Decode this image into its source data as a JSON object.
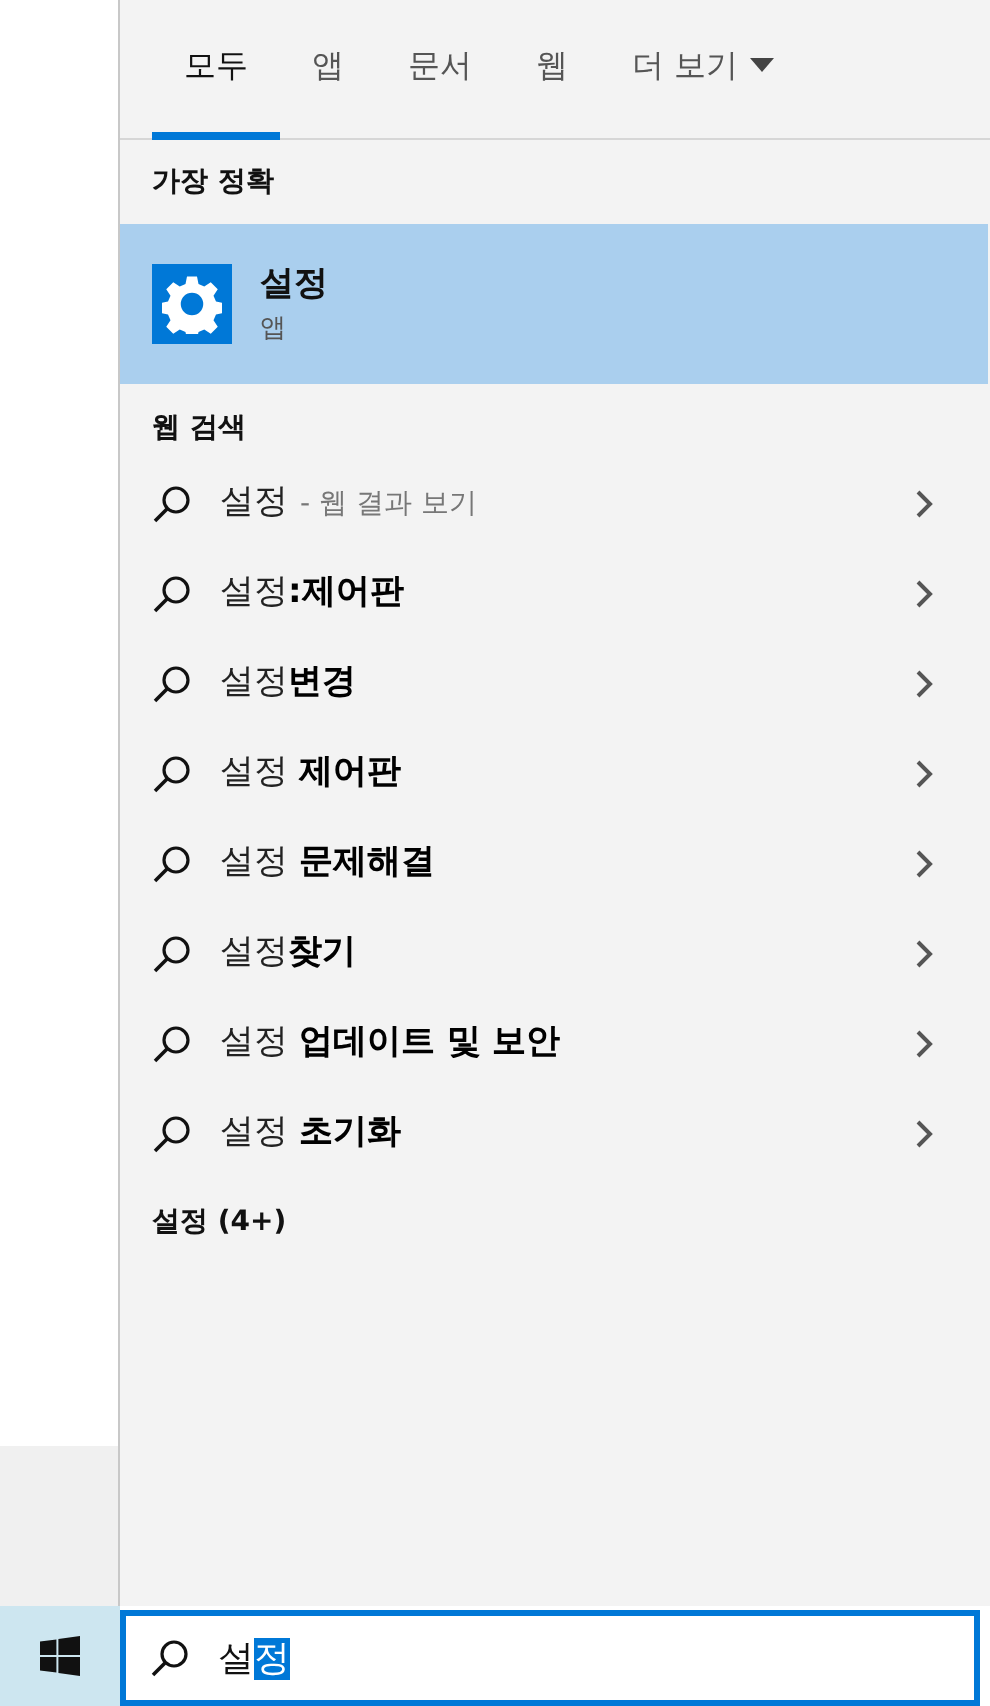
{
  "tabs": [
    {
      "label": "모두",
      "selected": true
    },
    {
      "label": "앱",
      "selected": false
    },
    {
      "label": "문서",
      "selected": false
    },
    {
      "label": "웹",
      "selected": false
    },
    {
      "label": "더 보기",
      "selected": false,
      "kind": "dropdown"
    }
  ],
  "best_match": {
    "heading": "가장 정확",
    "item": {
      "title": "설정",
      "subtitle": "앱",
      "selected": true
    }
  },
  "web_search": {
    "heading": "웹 검색",
    "items": [
      {
        "text": "설정",
        "hint": "- 웹 결과 보기"
      },
      {
        "text": "설정**:제어판**"
      },
      {
        "text": "설정**변경**"
      },
      {
        "text": "설정 **제어판**"
      },
      {
        "text": "설정 **문제해결**"
      },
      {
        "text": "설정**찾기**"
      },
      {
        "text": "설정 **업데이트 및 보안**"
      },
      {
        "text": "설정 **초기화**"
      }
    ]
  },
  "settings_section": {
    "heading": "설정 (4+)"
  },
  "search_box": {
    "value": "설",
    "selection": "정"
  }
}
